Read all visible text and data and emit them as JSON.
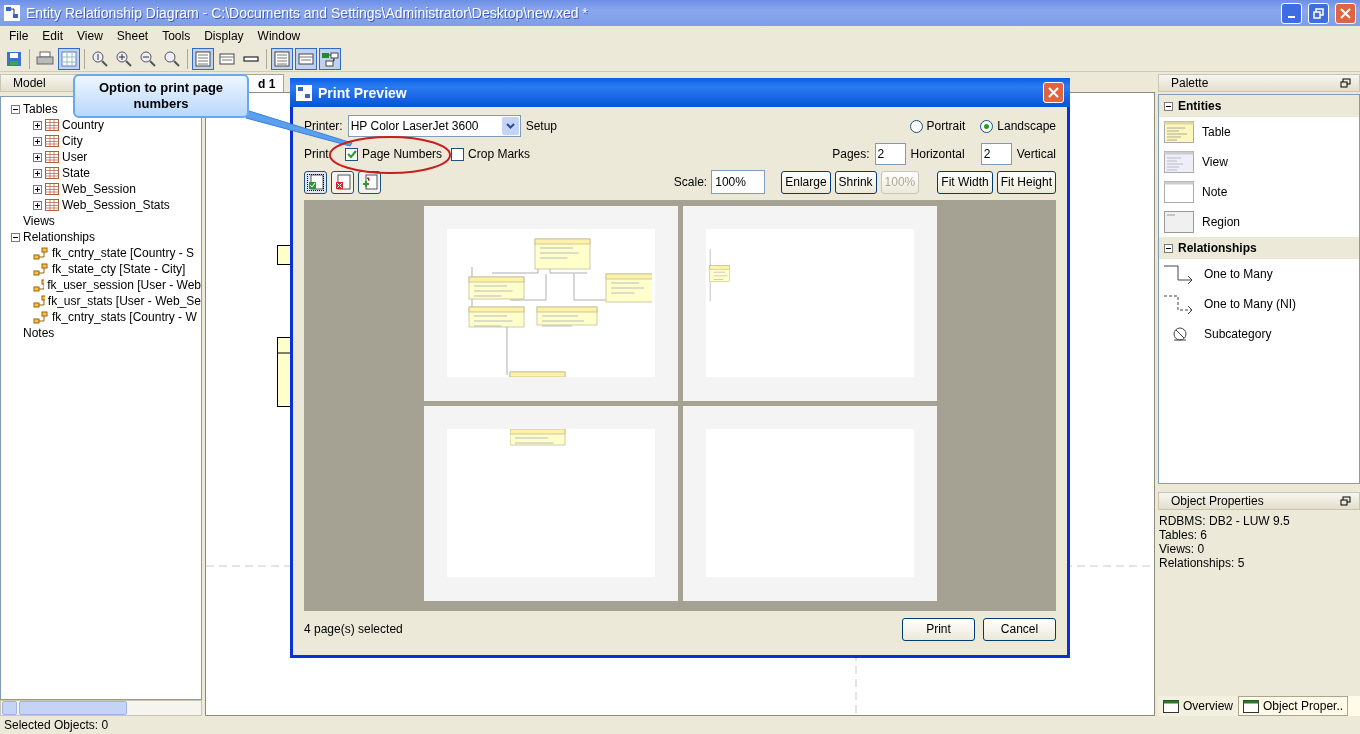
{
  "window": {
    "title": "Entity Relationship Diagram - C:\\Documents and Settings\\Administrator\\Desktop\\new.xed *"
  },
  "menu": [
    "File",
    "Edit",
    "View",
    "Sheet",
    "Tools",
    "Display",
    "Window"
  ],
  "toolbar": [
    {
      "kind": "save",
      "selected": false
    },
    {
      "kind": "print",
      "selected": false
    },
    {
      "kind": "page",
      "selected": true
    },
    {
      "kind": "zoom-one",
      "selected": false
    },
    {
      "kind": "zoom-in",
      "selected": false
    },
    {
      "kind": "zoom-out",
      "selected": false
    },
    {
      "kind": "zoom",
      "selected": false
    },
    {
      "kind": "full-table",
      "selected": true
    },
    {
      "kind": "keys-table",
      "selected": false
    },
    {
      "kind": "name-table",
      "selected": false
    },
    {
      "kind": "full-table",
      "selected": true
    },
    {
      "kind": "keys-table",
      "selected": true
    },
    {
      "kind": "diagram",
      "selected": true
    }
  ],
  "model_panel": {
    "title": "Model",
    "tree": [
      {
        "label": "Tables",
        "expanded": true,
        "children": [
          {
            "label": "Country",
            "kind": "table",
            "expanded": false
          },
          {
            "label": "City",
            "kind": "table",
            "expanded": false
          },
          {
            "label": "User",
            "kind": "table",
            "expanded": false
          },
          {
            "label": "State",
            "kind": "table",
            "expanded": false
          },
          {
            "label": "Web_Session",
            "kind": "table",
            "expanded": false
          },
          {
            "label": "Web_Session_Stats",
            "kind": "table",
            "expanded": false
          }
        ]
      },
      {
        "label": "Views"
      },
      {
        "label": "Relationships",
        "expanded": true,
        "children": [
          {
            "label": "fk_cntry_state [Country - S",
            "kind": "relationship"
          },
          {
            "label": "fk_state_cty [State - City]",
            "kind": "relationship"
          },
          {
            "label": "fk_user_session [User - Web",
            "kind": "relationship"
          },
          {
            "label": "fk_usr_stats [User - Web_Se",
            "kind": "relationship"
          },
          {
            "label": "fk_cntry_stats [Country - W",
            "kind": "relationship"
          }
        ]
      },
      {
        "label": "Notes"
      }
    ]
  },
  "document_tabs": [
    {
      "label": "d 1",
      "selected": true
    }
  ],
  "palette": {
    "title": "Palette",
    "sections": [
      {
        "title": "Entities",
        "expanded": true,
        "items": [
          {
            "label": "Table",
            "kind": "table"
          },
          {
            "label": "View",
            "kind": "view"
          },
          {
            "label": "Note",
            "kind": "note"
          },
          {
            "label": "Region",
            "kind": "region"
          }
        ]
      },
      {
        "title": "Relationships",
        "expanded": true,
        "items": [
          {
            "label": "One to Many",
            "kind": "one-to-many"
          },
          {
            "label": "One to Many (NI)",
            "kind": "one-to-many-ni"
          },
          {
            "label": "Subcategory",
            "kind": "subcategory"
          }
        ]
      }
    ]
  },
  "object_properties": {
    "title": "Object Properties",
    "lines": [
      "RDBMS: DB2 - LUW 9.5",
      "Tables: 6",
      "Views: 0",
      "Relationships: 5"
    ]
  },
  "bottom_tabs": [
    {
      "label": "Overview",
      "selected": false
    },
    {
      "label": "Object Proper..",
      "selected": true
    }
  ],
  "status_bar": "Selected Objects: 0",
  "callout": "Option to print page numbers",
  "print_preview": {
    "title": "Print Preview",
    "printer_label": "Printer:",
    "printer": "HP Color LaserJet 3600",
    "setup": "Setup",
    "orientation": [
      {
        "label": "Portrait",
        "selected": false
      },
      {
        "label": "Landscape",
        "selected": true
      }
    ],
    "print_label": "Print:",
    "print_options": [
      {
        "label": "Page Numbers",
        "checked": true,
        "circled": true
      },
      {
        "label": "Crop Marks",
        "checked": false,
        "circled": false
      }
    ],
    "pages_label": "Pages:",
    "horizontal": "2",
    "horizontal_label": "Horizontal",
    "vertical": "2",
    "vertical_label": "Vertical",
    "page_tools": [
      {
        "kind": "select-all",
        "selected": true
      },
      {
        "kind": "deselect-all",
        "selected": false
      },
      {
        "kind": "add",
        "selected": false
      }
    ],
    "scale_label": "Scale:",
    "scale": "100%",
    "zoom_buttons": [
      {
        "label": "Enlarge",
        "disabled": false
      },
      {
        "label": "Shrink",
        "disabled": false
      },
      {
        "label": "100%",
        "disabled": true
      }
    ],
    "fit_buttons": [
      {
        "label": "Fit Width",
        "disabled": false
      },
      {
        "label": "Fit Height",
        "disabled": false
      }
    ],
    "pages": [
      {
        "kind": "diagram-main"
      },
      {
        "kind": "diagram-right"
      },
      {
        "kind": "diagram-bottom"
      },
      {
        "kind": "blank"
      }
    ],
    "selection_status": "4 page(s) selected",
    "buttons": [
      "Print",
      "Cancel"
    ]
  }
}
